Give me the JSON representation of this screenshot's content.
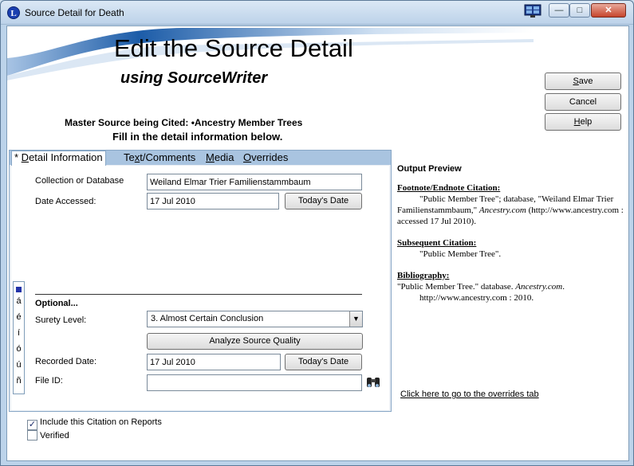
{
  "window": {
    "title": "Source Detail for Death",
    "app_icon_letter": "L",
    "min_symbol": "—",
    "max_symbol": "□",
    "close_symbol": "✕"
  },
  "header": {
    "title": "Edit the Source Detail",
    "subtitle": "using SourceWriter",
    "master_source": "Master Source being Cited: •Ancestry Member Trees",
    "instructions": "Fill in the detail information below."
  },
  "buttons": {
    "save_first": "S",
    "save_rest": "ave",
    "cancel": "Cancel",
    "help_first": "H",
    "help_rest": "elp"
  },
  "tabs": [
    {
      "prefix": "* ",
      "hot": "D",
      "rest": "etail Information"
    },
    {
      "prefix": "",
      "pre": "Te",
      "hot": "x",
      "rest": "t/Comments"
    },
    {
      "prefix": "",
      "hot": "M",
      "rest": "edia"
    },
    {
      "prefix": "",
      "hot": "O",
      "rest": "verrides"
    }
  ],
  "detail": {
    "collection_label": "Collection or Database",
    "collection_value": "Weiland Elmar Trier Familienstammbaum",
    "date_accessed_label": "Date Accessed:",
    "date_accessed_value": "17 Jul 2010",
    "todays_date_label": "Today's Date",
    "optional_label": "Optional...",
    "surety_label": "Surety Level:",
    "surety_value": "3.  Almost Certain Conclusion",
    "analyze_label": "Analyze Source Quality",
    "recorded_date_label": "Recorded Date:",
    "recorded_date_value": "17 Jul 2010",
    "recorded_todays_date_label": "Today's Date",
    "file_id_label": "File ID:",
    "file_id_value": ""
  },
  "special_chars": [
    "á",
    "é",
    "í",
    "ó",
    "ú",
    "ñ"
  ],
  "checkboxes": {
    "include_label": "Include this Citation on Reports",
    "include_checked": true,
    "verified_label": "Verified",
    "verified_checked": false
  },
  "preview": {
    "header": "Output Preview",
    "footnote_title": "Footnote/Endnote Citation:",
    "footnote_text_1": "\"Public Member Tree\"; database, \"Weiland Elmar Trier Familienstammbaum,\" ",
    "footnote_italic": "Ancestry.com",
    "footnote_text_2": " (http://www.ancestry.com : accessed 17 Jul 2010).",
    "subsequent_title": "Subsequent Citation:",
    "subsequent_text": "\"Public Member Tree\".",
    "bibliography_title": "Bibliography:",
    "bibliography_text_1": "\"Public Member Tree.\" database. ",
    "bibliography_italic": "Ancestry.com",
    "bibliography_text_2": ". http://www.ancestry.com : 2010.",
    "overrides_link": "Click here to go to the overrides tab"
  },
  "colors": {
    "title_bar": "#bcd2e9",
    "tab_strip": "#a9c4e0",
    "banner_wave": "#1c5ca8"
  }
}
